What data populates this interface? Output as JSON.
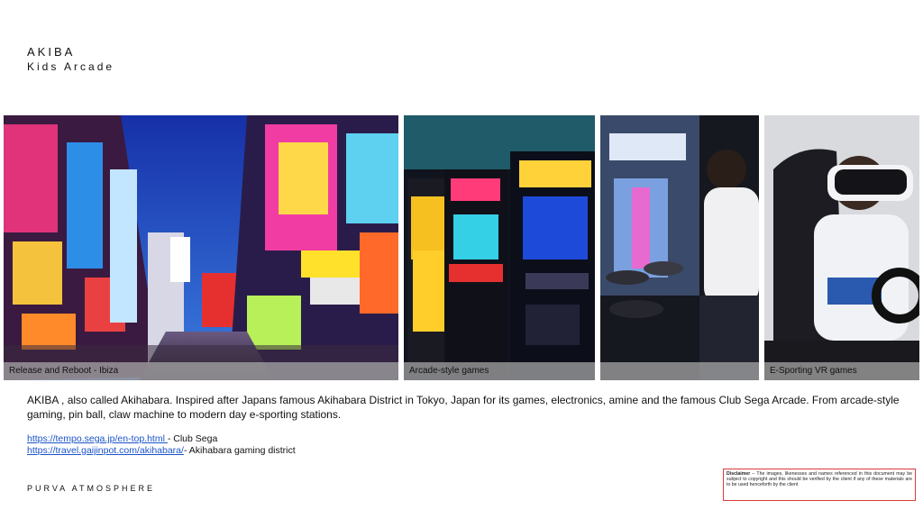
{
  "header": {
    "title": "AKIBA",
    "subtitle": "Kids Arcade"
  },
  "panels": [
    {
      "caption": "Release and Reboot - Ibiza",
      "image": "akihabara-street-neon-photo"
    },
    {
      "caption": "Arcade-style games",
      "image": "arcade-cabinets-photo"
    },
    {
      "caption": "",
      "image": "drum-rhythm-game-player-photo"
    },
    {
      "caption": "E-Sporting VR games",
      "image": "vr-racing-simulator-photo"
    }
  ],
  "description": "AKIBA , also called Akihabara. Inspired after Japans famous Akihabara District in Tokyo, Japan for its games, electronics, amine and the famous Club Sega Arcade. From arcade-style gaming, pin ball, claw machine to modern day e-sporting stations.",
  "links": [
    {
      "url": "https://tempo.sega.jp/en-top.html ",
      "suffix": "- Club Sega"
    },
    {
      "url": "https://travel.gaijinpot.com/akihabara/",
      "suffix": "- Akihabara gaming district"
    }
  ],
  "footer": {
    "brand": "PURVA ATMOSPHERE",
    "disclaimer_label": "Disclaimer",
    "disclaimer_text": " – The images, likenesses and names referenced in this document may be subject to copyright and this should be verified by the client if any of these materials are to be used henceforth by the client"
  },
  "colors": {
    "link": "#1a53c9",
    "disclaimer_border": "#d93a3a",
    "caption_bar": "#aaaaaa"
  }
}
